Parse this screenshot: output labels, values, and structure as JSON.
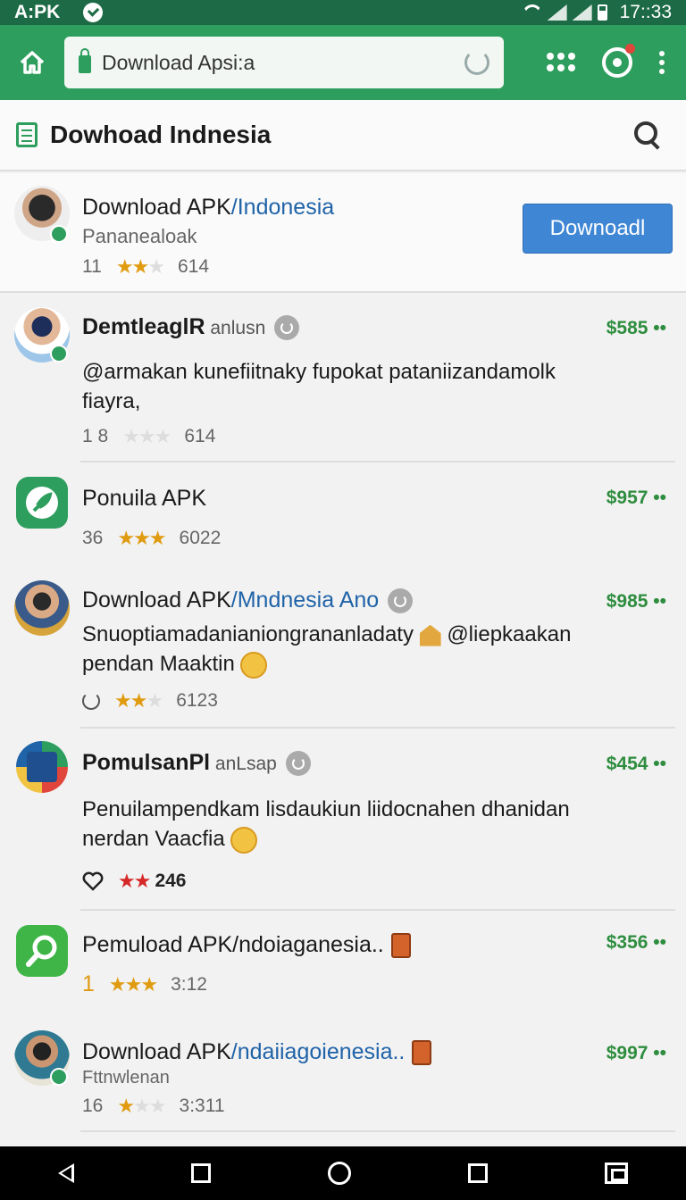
{
  "status": {
    "left_text": "A:PK",
    "time": "17::33"
  },
  "browser": {
    "url_text": "Download Apsi:a"
  },
  "page": {
    "title": "Dowhoad Indnesia"
  },
  "items": [
    {
      "title_a": "Download APK",
      "title_b": "/Indonesia",
      "subtitle": "Pananealoak",
      "count": "11",
      "rating": "614",
      "button": "Downoadl"
    },
    {
      "title_a": "DemtleaglR",
      "title_b": " anlusn",
      "price": "$585 ••",
      "desc": "@armakan kunefiitnaky fupokat pataniizandamolk fiayra,",
      "count": "1 8",
      "rating": "614"
    },
    {
      "title_a": "Ponuila APK",
      "price": "$957 ••",
      "count": "36",
      "rating": "6022"
    },
    {
      "title_a": "Download APK",
      "title_b": "/Mndnesia Ano",
      "price": "$985 ••",
      "desc1": "Snuoptiamadanianiongrananladaty",
      "desc2": "@liepkaakan",
      "desc3": "pendan Maaktin",
      "rating": "6123"
    },
    {
      "title_a": "PomulsanPl",
      "title_b": " anLsap",
      "price": "$454 ••",
      "desc1": "Penuilampendkam lisdaukiun liidocnahen dhanidan",
      "desc2": "nerdan Vaacfia",
      "rating": "246"
    },
    {
      "title_a": "Pemuload APK/ndoiaganesia..",
      "price": "$356 ••",
      "count": "1",
      "rating": "3:12"
    },
    {
      "title_a": "Download APK",
      "title_b": "/ndaiiagoienesia..",
      "price": "$997 ••",
      "subtitle": "Fttnwlenan",
      "count": "16",
      "rating": "3:311"
    }
  ]
}
